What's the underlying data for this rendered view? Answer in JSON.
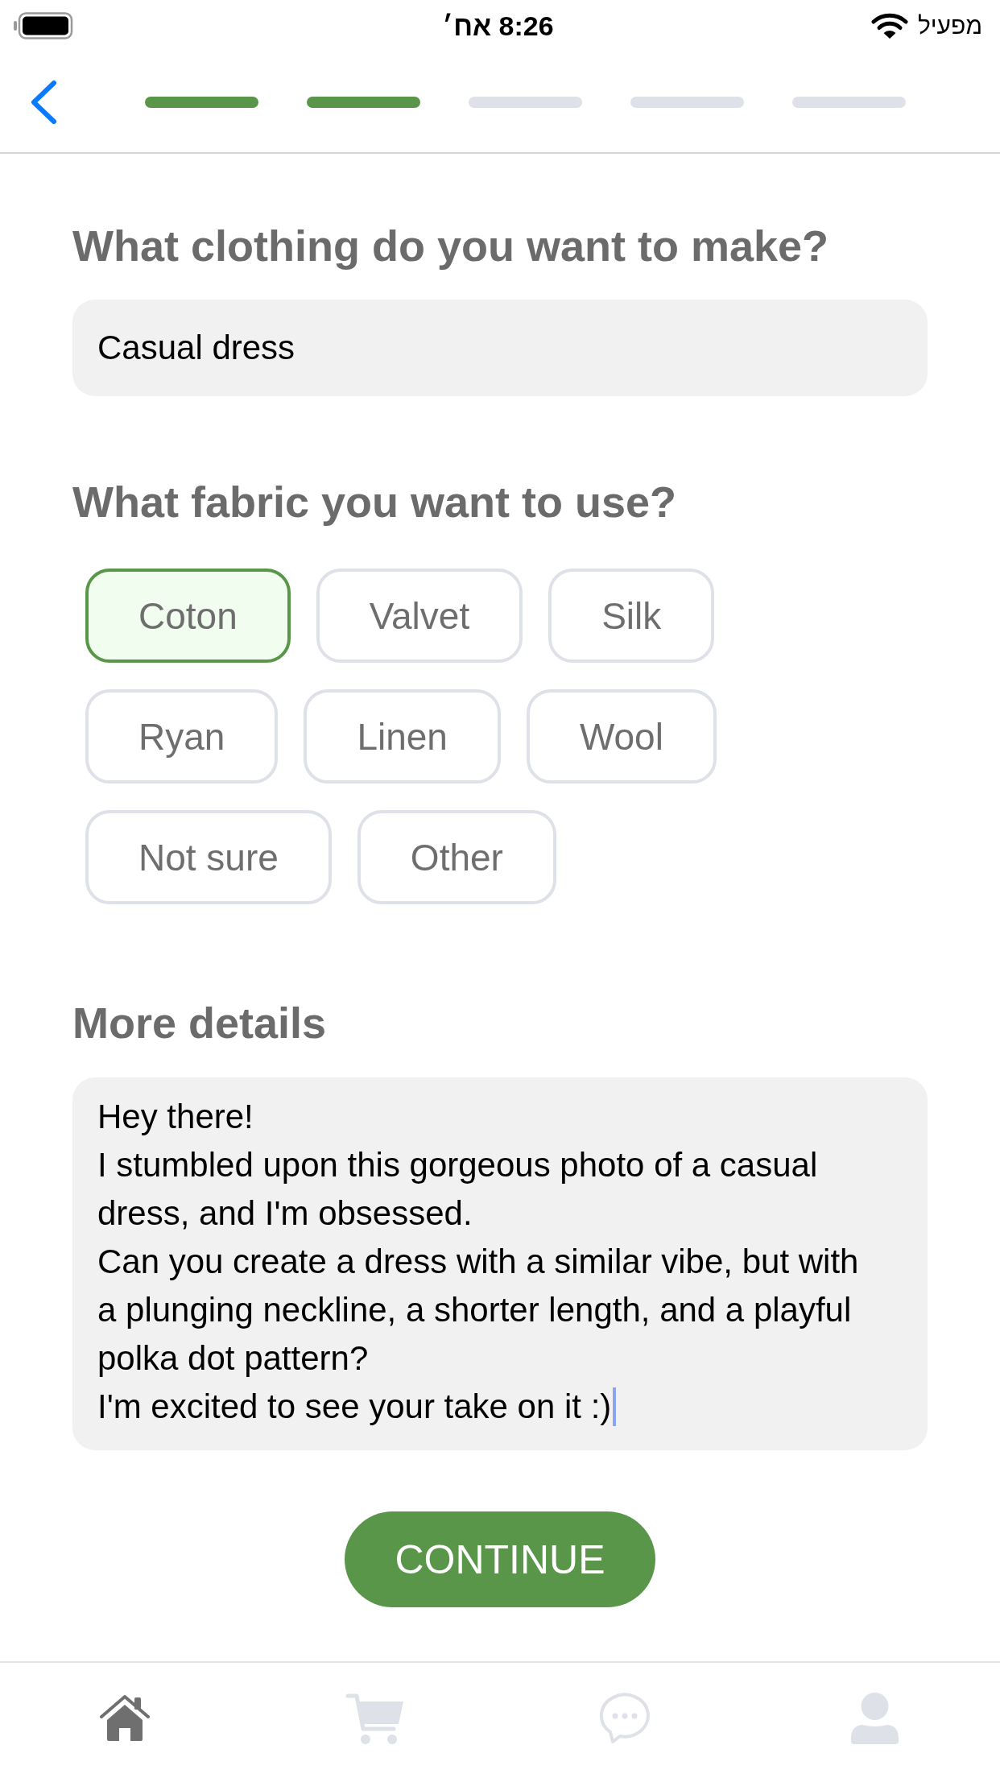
{
  "status_bar": {
    "time": "8:26 אח׳",
    "carrier": "מפעיל"
  },
  "header": {
    "progress_steps": [
      {
        "completed": true
      },
      {
        "completed": true
      },
      {
        "completed": false
      },
      {
        "completed": false
      },
      {
        "completed": false
      }
    ]
  },
  "clothing": {
    "label": "What clothing do you want to make?",
    "value": "Casual dress"
  },
  "fabric": {
    "label": "What fabric you want to use?",
    "options": [
      {
        "label": "Coton",
        "selected": true
      },
      {
        "label": "Valvet",
        "selected": false
      },
      {
        "label": "Silk",
        "selected": false
      },
      {
        "label": "Ryan",
        "selected": false
      },
      {
        "label": "Linen",
        "selected": false
      },
      {
        "label": "Wool",
        "selected": false
      },
      {
        "label": "Not sure",
        "selected": false
      },
      {
        "label": "Other",
        "selected": false
      }
    ]
  },
  "details": {
    "label": "More details",
    "value": "Hey there!\nI stumbled upon this gorgeous photo of a casual dress, and I'm obsessed.\nCan you create a dress with a similar vibe, but with a plunging neckline, a shorter length, and a playful polka dot pattern?\nI'm excited to see your take on it :)",
    "focused": true
  },
  "continue_button": {
    "label": "CONTINUE"
  },
  "tab_bar": {
    "items": [
      {
        "selected": true
      },
      {
        "selected": false
      },
      {
        "selected": false
      },
      {
        "selected": false
      }
    ]
  }
}
